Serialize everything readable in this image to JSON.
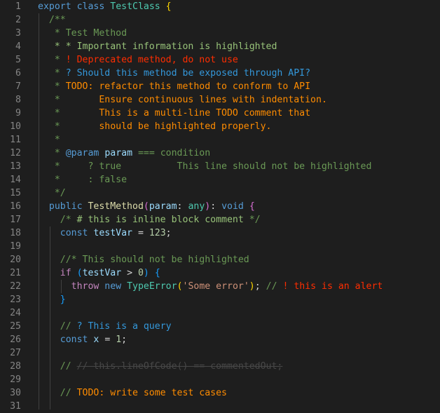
{
  "editor": {
    "lines": [
      {
        "n": "1",
        "t": [
          {
            "c": "kw",
            "v": "export"
          },
          {
            "c": "pun",
            "v": " "
          },
          {
            "c": "kw",
            "v": "class"
          },
          {
            "c": "pun",
            "v": " "
          },
          {
            "c": "cls",
            "v": "TestClass"
          },
          {
            "c": "pun",
            "v": " "
          },
          {
            "c": "br1",
            "v": "{"
          }
        ]
      },
      {
        "n": "2",
        "t": [
          {
            "c": "pun",
            "v": "  "
          },
          {
            "c": "cm",
            "v": "/**"
          }
        ]
      },
      {
        "n": "3",
        "t": [
          {
            "c": "pun",
            "v": "   "
          },
          {
            "c": "cm",
            "v": "* Test Method"
          }
        ]
      },
      {
        "n": "4",
        "t": [
          {
            "c": "pun",
            "v": "   "
          },
          {
            "c": "hl-imp",
            "v": "* * Important information is highlighted"
          }
        ]
      },
      {
        "n": "5",
        "t": [
          {
            "c": "pun",
            "v": "   "
          },
          {
            "c": "cm",
            "v": "* "
          },
          {
            "c": "hl-alert",
            "v": "! Deprecated method, do not use"
          }
        ]
      },
      {
        "n": "6",
        "t": [
          {
            "c": "pun",
            "v": "   "
          },
          {
            "c": "cm",
            "v": "* "
          },
          {
            "c": "hl-q",
            "v": "? Should this method be exposed through API?"
          }
        ]
      },
      {
        "n": "7",
        "t": [
          {
            "c": "pun",
            "v": "   "
          },
          {
            "c": "cm",
            "v": "* "
          },
          {
            "c": "hl-todo",
            "v": "TODO: refactor this method to conform to API"
          }
        ]
      },
      {
        "n": "8",
        "t": [
          {
            "c": "pun",
            "v": "   "
          },
          {
            "c": "cm",
            "v": "*"
          },
          {
            "c": "hl-todo",
            "v": "       Ensure continuous lines with indentation."
          }
        ]
      },
      {
        "n": "9",
        "t": [
          {
            "c": "pun",
            "v": "   "
          },
          {
            "c": "cm",
            "v": "*"
          },
          {
            "c": "hl-todo",
            "v": "       This is a multi-line TODO comment that"
          }
        ]
      },
      {
        "n": "10",
        "t": [
          {
            "c": "pun",
            "v": "   "
          },
          {
            "c": "cm",
            "v": "*"
          },
          {
            "c": "hl-todo",
            "v": "       should be highlighted properly."
          }
        ]
      },
      {
        "n": "11",
        "t": [
          {
            "c": "pun",
            "v": "   "
          },
          {
            "c": "cm",
            "v": "*"
          }
        ]
      },
      {
        "n": "12",
        "t": [
          {
            "c": "pun",
            "v": "   "
          },
          {
            "c": "cm",
            "v": "* "
          },
          {
            "c": "kw",
            "v": "@param"
          },
          {
            "c": "cm",
            "v": " "
          },
          {
            "c": "var",
            "v": "param"
          },
          {
            "c": "cm",
            "v": " === condition"
          }
        ]
      },
      {
        "n": "13",
        "t": [
          {
            "c": "pun",
            "v": "   "
          },
          {
            "c": "cm",
            "v": "*     ? true          This line should not be highlighted"
          }
        ]
      },
      {
        "n": "14",
        "t": [
          {
            "c": "pun",
            "v": "   "
          },
          {
            "c": "cm",
            "v": "*     : false"
          }
        ]
      },
      {
        "n": "15",
        "t": [
          {
            "c": "pun",
            "v": "   "
          },
          {
            "c": "cm",
            "v": "*/"
          }
        ]
      },
      {
        "n": "16",
        "t": [
          {
            "c": "pun",
            "v": "  "
          },
          {
            "c": "kw",
            "v": "public"
          },
          {
            "c": "pun",
            "v": " "
          },
          {
            "c": "fn",
            "v": "TestMethod"
          },
          {
            "c": "br2",
            "v": "("
          },
          {
            "c": "var",
            "v": "param"
          },
          {
            "c": "pun",
            "v": ": "
          },
          {
            "c": "cls",
            "v": "any"
          },
          {
            "c": "br2",
            "v": ")"
          },
          {
            "c": "pun",
            "v": ": "
          },
          {
            "c": "kw",
            "v": "void"
          },
          {
            "c": "pun",
            "v": " "
          },
          {
            "c": "br2",
            "v": "{"
          }
        ]
      },
      {
        "n": "17",
        "t": [
          {
            "c": "pun",
            "v": "    "
          },
          {
            "c": "cm",
            "v": "/* "
          },
          {
            "c": "hl-imp",
            "v": "# this is inline block comment"
          },
          {
            "c": "cm",
            "v": " */"
          }
        ]
      },
      {
        "n": "18",
        "t": [
          {
            "c": "pun",
            "v": "    "
          },
          {
            "c": "kw",
            "v": "const"
          },
          {
            "c": "pun",
            "v": " "
          },
          {
            "c": "var",
            "v": "testVar"
          },
          {
            "c": "pun",
            "v": " = "
          },
          {
            "c": "num",
            "v": "123"
          },
          {
            "c": "pun",
            "v": ";"
          }
        ]
      },
      {
        "n": "19",
        "t": []
      },
      {
        "n": "20",
        "t": [
          {
            "c": "pun",
            "v": "    "
          },
          {
            "c": "cm",
            "v": "//* This should not be highlighted"
          }
        ]
      },
      {
        "n": "21",
        "t": [
          {
            "c": "pun",
            "v": "    "
          },
          {
            "c": "kw2",
            "v": "if"
          },
          {
            "c": "pun",
            "v": " "
          },
          {
            "c": "br3",
            "v": "("
          },
          {
            "c": "var",
            "v": "testVar"
          },
          {
            "c": "pun",
            "v": " > "
          },
          {
            "c": "num",
            "v": "0"
          },
          {
            "c": "br3",
            "v": ")"
          },
          {
            "c": "pun",
            "v": " "
          },
          {
            "c": "br3",
            "v": "{"
          }
        ]
      },
      {
        "n": "22",
        "t": [
          {
            "c": "pun",
            "v": "      "
          },
          {
            "c": "kw2",
            "v": "throw"
          },
          {
            "c": "pun",
            "v": " "
          },
          {
            "c": "kw",
            "v": "new"
          },
          {
            "c": "pun",
            "v": " "
          },
          {
            "c": "cls",
            "v": "TypeError"
          },
          {
            "c": "br1",
            "v": "("
          },
          {
            "c": "str",
            "v": "'Some error'"
          },
          {
            "c": "br1",
            "v": ")"
          },
          {
            "c": "pun",
            "v": "; "
          },
          {
            "c": "cm",
            "v": "// "
          },
          {
            "c": "hl-alert",
            "v": "! this is an alert"
          }
        ]
      },
      {
        "n": "23",
        "t": [
          {
            "c": "pun",
            "v": "    "
          },
          {
            "c": "br3",
            "v": "}"
          }
        ]
      },
      {
        "n": "24",
        "t": []
      },
      {
        "n": "25",
        "t": [
          {
            "c": "pun",
            "v": "    "
          },
          {
            "c": "cm",
            "v": "// "
          },
          {
            "c": "hl-q",
            "v": "? This is a query"
          }
        ]
      },
      {
        "n": "26",
        "t": [
          {
            "c": "pun",
            "v": "    "
          },
          {
            "c": "kw",
            "v": "const"
          },
          {
            "c": "pun",
            "v": " "
          },
          {
            "c": "var",
            "v": "x"
          },
          {
            "c": "pun",
            "v": " = "
          },
          {
            "c": "num",
            "v": "1"
          },
          {
            "c": "pun",
            "v": ";"
          }
        ]
      },
      {
        "n": "27",
        "t": []
      },
      {
        "n": "28",
        "t": [
          {
            "c": "pun",
            "v": "    "
          },
          {
            "c": "cm",
            "v": "// "
          },
          {
            "c": "strike",
            "v": "// this.lineOfCode() == commentedOut;"
          }
        ]
      },
      {
        "n": "29",
        "t": []
      },
      {
        "n": "30",
        "t": [
          {
            "c": "pun",
            "v": "    "
          },
          {
            "c": "cm",
            "v": "// "
          },
          {
            "c": "hl-todo",
            "v": "TODO: write some test cases"
          }
        ]
      },
      {
        "n": "31",
        "t": []
      }
    ]
  }
}
